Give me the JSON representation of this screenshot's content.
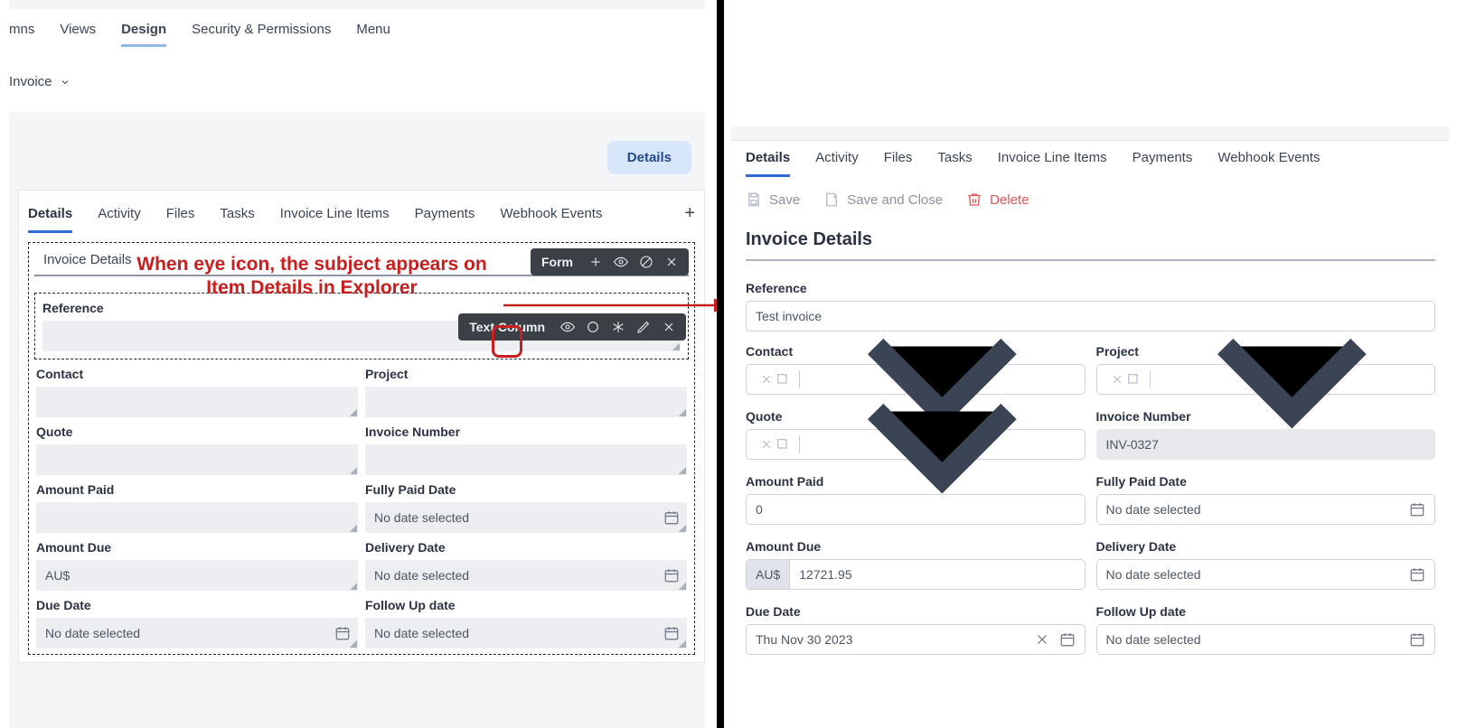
{
  "left": {
    "topTabs": [
      "mns",
      "Views",
      "Design",
      "Security & Permissions",
      "Menu"
    ],
    "topActiveIndex": 2,
    "entityName": "Invoice",
    "detailsChip": "Details",
    "subTabs": [
      "Details",
      "Activity",
      "Files",
      "Tasks",
      "Invoice Line Items",
      "Payments",
      "Webhook Events"
    ],
    "subActiveIndex": 0,
    "sectionTitle": "Invoice Details",
    "formToolbarLabel": "Form",
    "columnToolbarLabel": "Text Column",
    "annotation": "When eye icon, the subject appears on Item Details in Explorer",
    "fields": {
      "reference": "Reference",
      "contact": "Contact",
      "project": "Project",
      "quote": "Quote",
      "invoiceNumber": "Invoice Number",
      "amountPaid": "Amount Paid",
      "fullyPaidDate": "Fully Paid Date",
      "amountDue": "Amount Due",
      "deliveryDate": "Delivery Date",
      "dueDate": "Due Date",
      "followUpDate": "Follow Up date"
    },
    "placeholders": {
      "noDate": "No date selected",
      "currencyPrefix": "AU$"
    }
  },
  "right": {
    "tabs": [
      "Details",
      "Activity",
      "Files",
      "Tasks",
      "Invoice Line Items",
      "Payments",
      "Webhook Events"
    ],
    "tabActiveIndex": 0,
    "actions": {
      "save": "Save",
      "saveClose": "Save and Close",
      "delete": "Delete"
    },
    "sectionTitle": "Invoice Details",
    "labels": {
      "reference": "Reference",
      "contact": "Contact",
      "project": "Project",
      "quote": "Quote",
      "invoiceNumber": "Invoice Number",
      "amountPaid": "Amount Paid",
      "fullyPaidDate": "Fully Paid Date",
      "amountDue": "Amount Due",
      "deliveryDate": "Delivery Date",
      "dueDate": "Due Date",
      "followUpDate": "Follow Up date"
    },
    "values": {
      "reference": "Test invoice",
      "invoiceNumber": "INV-0327",
      "amountPaid": "0",
      "amountDueCurrency": "AU$",
      "amountDue": "12721.95",
      "dueDate": "Thu Nov 30 2023",
      "noDate": "No date selected"
    }
  }
}
